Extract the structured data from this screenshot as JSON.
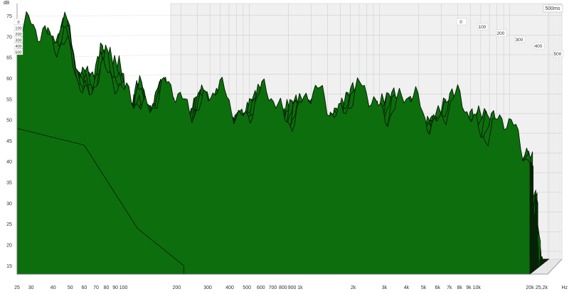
{
  "chart_data": {
    "type": "waterfall-3d",
    "title": "",
    "y_unit_label": "dB",
    "x_unit_label": "Hz",
    "time_unit_label": "500ms",
    "y_ticks": [
      "75",
      "70",
      "65",
      "60",
      "55",
      "50",
      "45",
      "40",
      "35",
      "30",
      "25",
      "20",
      "15"
    ],
    "x_ticks": [
      "25",
      "30",
      "40",
      "50",
      "60",
      "70",
      "80",
      "90",
      "100",
      "200",
      "300",
      "400",
      "500",
      "600",
      "700",
      "800",
      "900",
      "1k",
      "2k",
      "3k",
      "4k",
      "5k",
      "6k",
      "7k",
      "8k",
      "9k",
      "10k",
      "20k",
      "25,2k"
    ],
    "time_ticks": [
      "0",
      "100",
      "200",
      "300",
      "400",
      "500"
    ],
    "left_depth_labels": [
      "0",
      "100",
      "200",
      "300",
      "400",
      "500"
    ],
    "ylim": [
      13,
      78
    ],
    "xlim_hz": [
      25,
      25200
    ],
    "time_range_ms": [
      0,
      500
    ],
    "slice_count": 30,
    "fill_color": "#0d6e0d",
    "line_color": "#051a05",
    "back_wall_color": "#f0f0f0",
    "floor_color": "#e8e8e8",
    "grid_color": "#c8c8c8",
    "front_response_db": [
      {
        "hz": 25,
        "db": 66
      },
      {
        "hz": 28,
        "db": 68
      },
      {
        "hz": 32,
        "db": 71
      },
      {
        "hz": 36,
        "db": 73
      },
      {
        "hz": 40,
        "db": 70
      },
      {
        "hz": 45,
        "db": 66
      },
      {
        "hz": 50,
        "db": 62
      },
      {
        "hz": 55,
        "db": 57
      },
      {
        "hz": 60,
        "db": 55
      },
      {
        "hz": 65,
        "db": 58
      },
      {
        "hz": 70,
        "db": 63
      },
      {
        "hz": 75,
        "db": 66
      },
      {
        "hz": 80,
        "db": 61
      },
      {
        "hz": 90,
        "db": 56
      },
      {
        "hz": 100,
        "db": 53
      },
      {
        "hz": 120,
        "db": 57
      },
      {
        "hz": 150,
        "db": 55
      },
      {
        "hz": 200,
        "db": 55
      },
      {
        "hz": 250,
        "db": 56
      },
      {
        "hz": 300,
        "db": 54
      },
      {
        "hz": 400,
        "db": 55
      },
      {
        "hz": 500,
        "db": 53
      },
      {
        "hz": 700,
        "db": 54
      },
      {
        "hz": 1000,
        "db": 53
      },
      {
        "hz": 1500,
        "db": 55
      },
      {
        "hz": 2000,
        "db": 54
      },
      {
        "hz": 3000,
        "db": 55
      },
      {
        "hz": 4000,
        "db": 53
      },
      {
        "hz": 6000,
        "db": 52
      },
      {
        "hz": 8000,
        "db": 52
      },
      {
        "hz": 12000,
        "db": 50
      },
      {
        "hz": 20000,
        "db": 49
      }
    ]
  }
}
